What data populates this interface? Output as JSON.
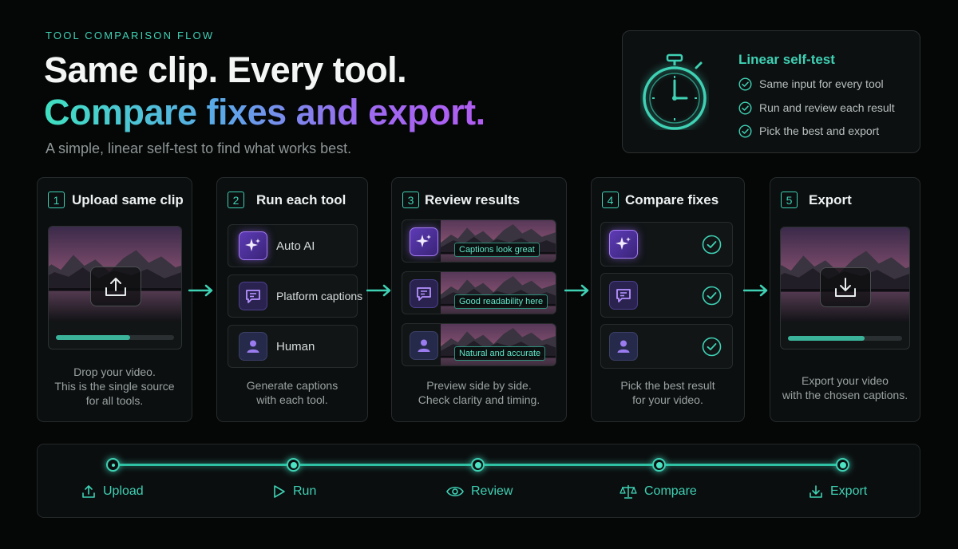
{
  "header": {
    "eyebrow": "TOOL COMPARISON FLOW",
    "title_line1": "Same clip. Every tool.",
    "title_line2": "Compare fixes and export.",
    "subtitle": "A simple, linear self-test to find what works best."
  },
  "self_test": {
    "title": "Linear self-test",
    "icon": "stopwatch-icon",
    "items": [
      "Same input for every tool",
      "Run and review each result",
      "Pick the best and export"
    ]
  },
  "steps": [
    {
      "number": "1",
      "title": "Upload same clip",
      "icon": "upload-icon",
      "progress": 0.63,
      "caption": [
        "Drop your video.",
        "This is the single source",
        "for all tools."
      ]
    },
    {
      "number": "2",
      "title": "Run each tool",
      "tools": [
        {
          "icon": "sparkle-icon",
          "label": "Auto AI"
        },
        {
          "icon": "caption-bubble-icon",
          "label": "Platform captions"
        },
        {
          "icon": "person-icon",
          "label": "Human"
        }
      ],
      "caption": [
        "Generate captions",
        "with each tool."
      ]
    },
    {
      "number": "3",
      "title": "Review results",
      "results": [
        {
          "icon": "sparkle-icon",
          "tag": "Captions look great"
        },
        {
          "icon": "caption-bubble-icon",
          "tag": "Good readability here"
        },
        {
          "icon": "person-icon",
          "tag": "Natural and accurate"
        }
      ],
      "caption": [
        "Preview side by side.",
        "Check clarity and timing."
      ]
    },
    {
      "number": "4",
      "title": "Compare fixes",
      "rows": [
        {
          "icon": "sparkle-icon",
          "status": "check-circle-icon"
        },
        {
          "icon": "caption-bubble-icon",
          "status": "check-circle-icon"
        },
        {
          "icon": "person-icon",
          "status": "check-circle-icon"
        }
      ],
      "caption": [
        "Pick the best result",
        "for your video."
      ]
    },
    {
      "number": "5",
      "title": "Export",
      "icon": "download-icon",
      "progress": 0.67,
      "caption": [
        "Export your video",
        "with the chosen captions."
      ]
    }
  ],
  "timeline": [
    {
      "label": "Upload",
      "icon": "upload-icon"
    },
    {
      "label": "Run",
      "icon": "play-icon"
    },
    {
      "label": "Review",
      "icon": "eye-icon"
    },
    {
      "label": "Compare",
      "icon": "scale-icon"
    },
    {
      "label": "Export",
      "icon": "download-icon"
    }
  ],
  "colors": {
    "accent": "#3ed1b4",
    "purple": "#a67cf5",
    "background": "#050606"
  }
}
